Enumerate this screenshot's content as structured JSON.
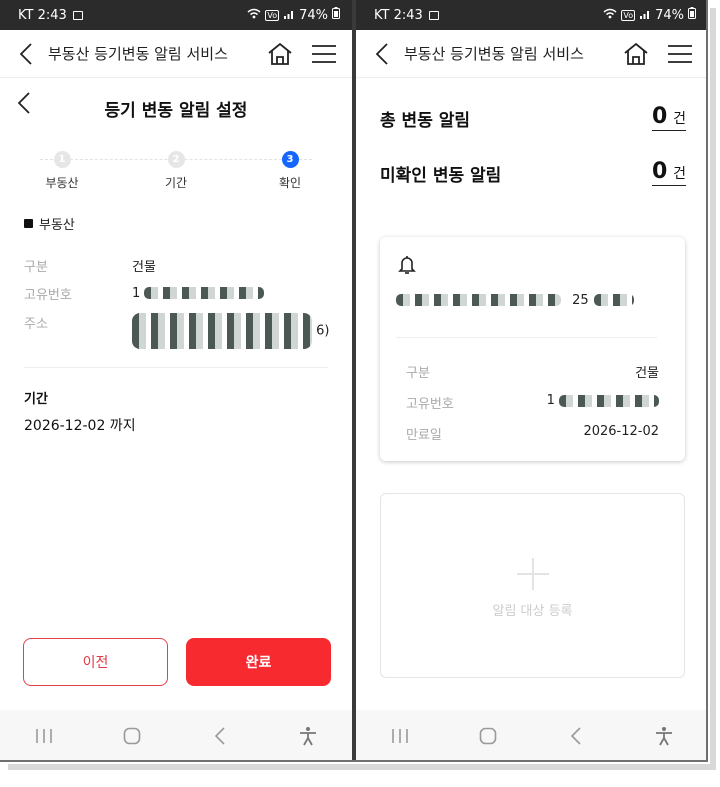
{
  "status": {
    "time": "KT 2:43",
    "battery": "74%"
  },
  "appbar": {
    "title": "부동산 등기변동 알림 서비스"
  },
  "left": {
    "title": "등기 변동 알림 설정",
    "steps": [
      {
        "num": "1",
        "label": "부동산"
      },
      {
        "num": "2",
        "label": "기간"
      },
      {
        "num": "3",
        "label": "확인"
      }
    ],
    "section_title": "부동산",
    "fields": [
      {
        "key": "구분",
        "value": "건물"
      },
      {
        "key": "고유번호",
        "value": "1"
      },
      {
        "key": "주소",
        "value": "6)"
      }
    ],
    "period_title": "기간",
    "period_value": "2026-12-02 까지",
    "prev_label": "이전",
    "done_label": "완료"
  },
  "right": {
    "total_label": "총 변동 알림",
    "total_value": "0",
    "unconfirmed_label": "미확인 변동 알림",
    "unconfirmed_value": "0",
    "unit": "건",
    "card": {
      "address_suffix": "25",
      "fields": [
        {
          "key": "구분",
          "value": "건물"
        },
        {
          "key": "고유번호",
          "value": "1"
        },
        {
          "key": "만료일",
          "value": "2026-12-02"
        }
      ]
    },
    "add_label": "알림 대상 등록"
  },
  "colors": {
    "primary_red": "#f62a2f",
    "active_step": "#1565ff"
  },
  "icons": [
    "back-icon",
    "home-icon",
    "menu-icon",
    "bell-icon",
    "plus-icon",
    "recent-apps-icon",
    "home-nav-icon",
    "back-nav-icon",
    "accessibility-icon"
  ]
}
